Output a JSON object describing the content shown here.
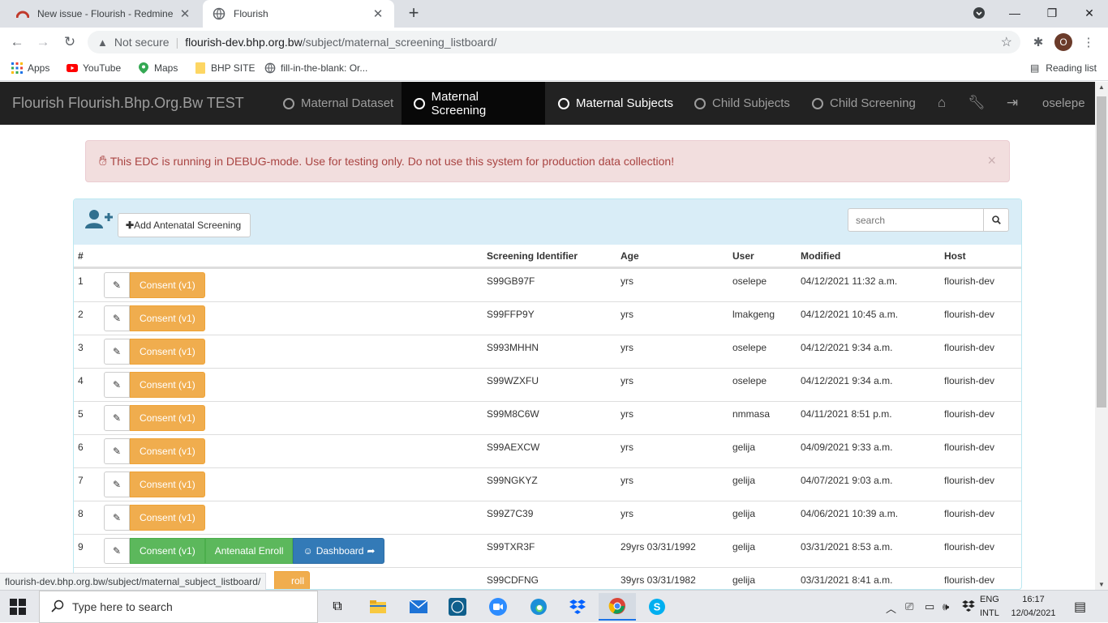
{
  "browser": {
    "tabs": [
      {
        "title": "New issue - Flourish - Redmine",
        "favicon": "redmine-icon"
      },
      {
        "title": "Flourish",
        "favicon": "globe-icon"
      }
    ],
    "address": {
      "security": "Not secure",
      "host": "flourish-dev.bhp.org.bw",
      "path": "/subject/maternal_screening_listboard/"
    },
    "bookmarks": [
      "Apps",
      "YouTube",
      "Maps",
      "BHP SITE",
      "fill-in-the-blank: Or..."
    ],
    "reading_list": "Reading list",
    "profile_initial": "O",
    "status_url": "flourish-dev.bhp.org.bw/subject/maternal_subject_listboard/"
  },
  "app": {
    "brand": "Flourish Flourish.Bhp.Org.Bw TEST",
    "nav": [
      "Maternal Dataset",
      "Maternal Screening",
      "Maternal Subjects",
      "Child Subjects",
      "Child Screening"
    ],
    "user": "oselepe",
    "alert": "This EDC is running in DEBUG-mode. Use for testing only. Do not use this system for production data collection!",
    "add_button": "Add Antenatal Screening",
    "search_placeholder": "search",
    "columns": [
      "#",
      "Screening Identifier",
      "Age",
      "User",
      "Modified",
      "Host"
    ],
    "rows": [
      {
        "num": "1",
        "id": "S99GB97F",
        "age": "yrs",
        "user": "oselepe",
        "modified": "04/12/2021 11:32 a.m.",
        "host": "flourish-dev",
        "consent": "Consent (v1)"
      },
      {
        "num": "2",
        "id": "S99FFP9Y",
        "age": "yrs",
        "user": "lmakgeng",
        "modified": "04/12/2021 10:45 a.m.",
        "host": "flourish-dev",
        "consent": "Consent (v1)"
      },
      {
        "num": "3",
        "id": "S993MHHN",
        "age": "yrs",
        "user": "oselepe",
        "modified": "04/12/2021 9:34 a.m.",
        "host": "flourish-dev",
        "consent": "Consent (v1)"
      },
      {
        "num": "4",
        "id": "S99WZXFU",
        "age": "yrs",
        "user": "oselepe",
        "modified": "04/12/2021 9:34 a.m.",
        "host": "flourish-dev",
        "consent": "Consent (v1)"
      },
      {
        "num": "5",
        "id": "S99M8C6W",
        "age": "yrs",
        "user": "nmmasa",
        "modified": "04/11/2021 8:51 p.m.",
        "host": "flourish-dev",
        "consent": "Consent (v1)"
      },
      {
        "num": "6",
        "id": "S99AEXCW",
        "age": "yrs",
        "user": "gelija",
        "modified": "04/09/2021 9:33 a.m.",
        "host": "flourish-dev",
        "consent": "Consent (v1)"
      },
      {
        "num": "7",
        "id": "S99NGKYZ",
        "age": "yrs",
        "user": "gelija",
        "modified": "04/07/2021 9:03 a.m.",
        "host": "flourish-dev",
        "consent": "Consent (v1)"
      },
      {
        "num": "8",
        "id": "S99Z7C39",
        "age": "yrs",
        "user": "gelija",
        "modified": "04/06/2021 10:39 a.m.",
        "host": "flourish-dev",
        "consent": "Consent (v1)"
      },
      {
        "num": "9",
        "id": "S99TXR3F",
        "age": "29yrs 03/31/1992",
        "user": "gelija",
        "modified": "03/31/2021 8:53 a.m.",
        "host": "flourish-dev",
        "consent": "Consent (v1)",
        "enroll": "Antenatal Enroll",
        "dashboard": "Dashboard"
      },
      {
        "num": "",
        "id": "S99CDFNG",
        "age": "39yrs 03/31/1982",
        "user": "gelija",
        "modified": "03/31/2021 8:41 a.m.",
        "host": "flourish-dev",
        "partial_button": "roll"
      }
    ]
  },
  "taskbar": {
    "search_placeholder": "Type here to search",
    "lang_top": "ENG",
    "lang_bottom": "INTL",
    "time": "16:17",
    "date": "12/04/2021"
  }
}
